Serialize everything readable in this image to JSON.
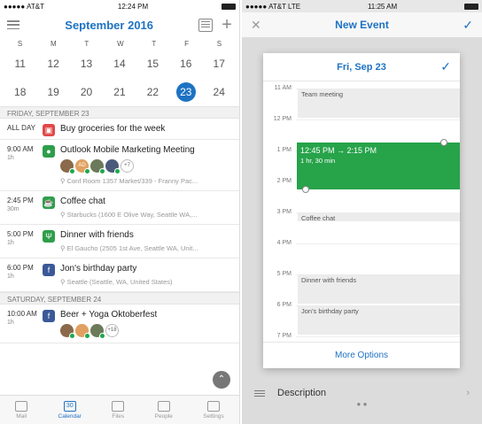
{
  "left": {
    "status": {
      "carrier": "AT&T",
      "time": "12:24 PM"
    },
    "header": {
      "title": "September 2016"
    },
    "days_of_week": [
      "S",
      "M",
      "T",
      "W",
      "T",
      "F",
      "S"
    ],
    "weeks": [
      [
        "11",
        "12",
        "13",
        "14",
        "15",
        "16",
        "17"
      ],
      [
        "18",
        "19",
        "20",
        "21",
        "22",
        "23",
        "24"
      ]
    ],
    "today": "23",
    "sections": [
      {
        "label": "FRIDAY, SEPTEMBER 23",
        "events": [
          {
            "time": "ALL DAY",
            "duration": "",
            "title": "Buy groceries for the week",
            "location": "",
            "color": "#e04848",
            "icon": "calendar-icon"
          },
          {
            "time": "9:00 AM",
            "duration": "1h",
            "title": "Outlook Mobile Marketing Meeting",
            "location": "Conf Room 1357 Market/339 - Franny Pac...",
            "color": "#2e9e4a",
            "icon": "chat-icon",
            "more": "+7",
            "avatar_initials": "AD"
          },
          {
            "time": "2:45 PM",
            "duration": "30m",
            "title": "Coffee chat",
            "location": "Starbucks (1600 E Olive Way, Seattle WA,...",
            "color": "#2e9e4a",
            "icon": "coffee-icon"
          },
          {
            "time": "5:00 PM",
            "duration": "1h",
            "title": "Dinner with friends",
            "location": "El Gaucho (2505 1st Ave, Seattle WA, Unit...",
            "color": "#2e9e4a",
            "icon": "fork-knife-icon"
          },
          {
            "time": "6:00 PM",
            "duration": "1h",
            "title": "Jon's birthday party",
            "location": "Seattle (Seattle, WA, United States)",
            "color": "#3b5998",
            "icon": "facebook-icon"
          }
        ]
      },
      {
        "label": "SATURDAY, SEPTEMBER 24",
        "events": [
          {
            "time": "10:00 AM",
            "duration": "1h",
            "title": "Beer + Yoga Oktoberfest",
            "location": "",
            "color": "#3b5998",
            "icon": "facebook-icon",
            "more": "+18"
          }
        ]
      }
    ],
    "tabs": [
      {
        "label": "Mail",
        "icon": "mail-icon"
      },
      {
        "label": "Calendar",
        "icon": "calendar-icon",
        "active": true,
        "glyph": "30"
      },
      {
        "label": "Files",
        "icon": "files-icon"
      },
      {
        "label": "People",
        "icon": "people-icon"
      },
      {
        "label": "Settings",
        "icon": "gear-icon"
      }
    ]
  },
  "right": {
    "status": {
      "carrier": "AT&T",
      "network": "LTE",
      "time": "11:25 AM"
    },
    "header": {
      "title": "New Event"
    },
    "modal": {
      "date": "Fri, Sep 23",
      "hours": [
        "11 AM",
        "12 PM",
        "1 PM",
        "2 PM",
        "3 PM",
        "4 PM",
        "5 PM",
        "6 PM",
        "7 PM"
      ],
      "blocks": [
        {
          "label": "Team meeting"
        },
        {
          "label": "Coffee chat"
        },
        {
          "label": "Dinner with friends"
        },
        {
          "label": "Jon's birthday party"
        }
      ],
      "selection": {
        "range": "12:45 PM → 2:15 PM",
        "duration": "1 hr, 30 min"
      },
      "footer": "More Options"
    },
    "description_label": "Description"
  }
}
